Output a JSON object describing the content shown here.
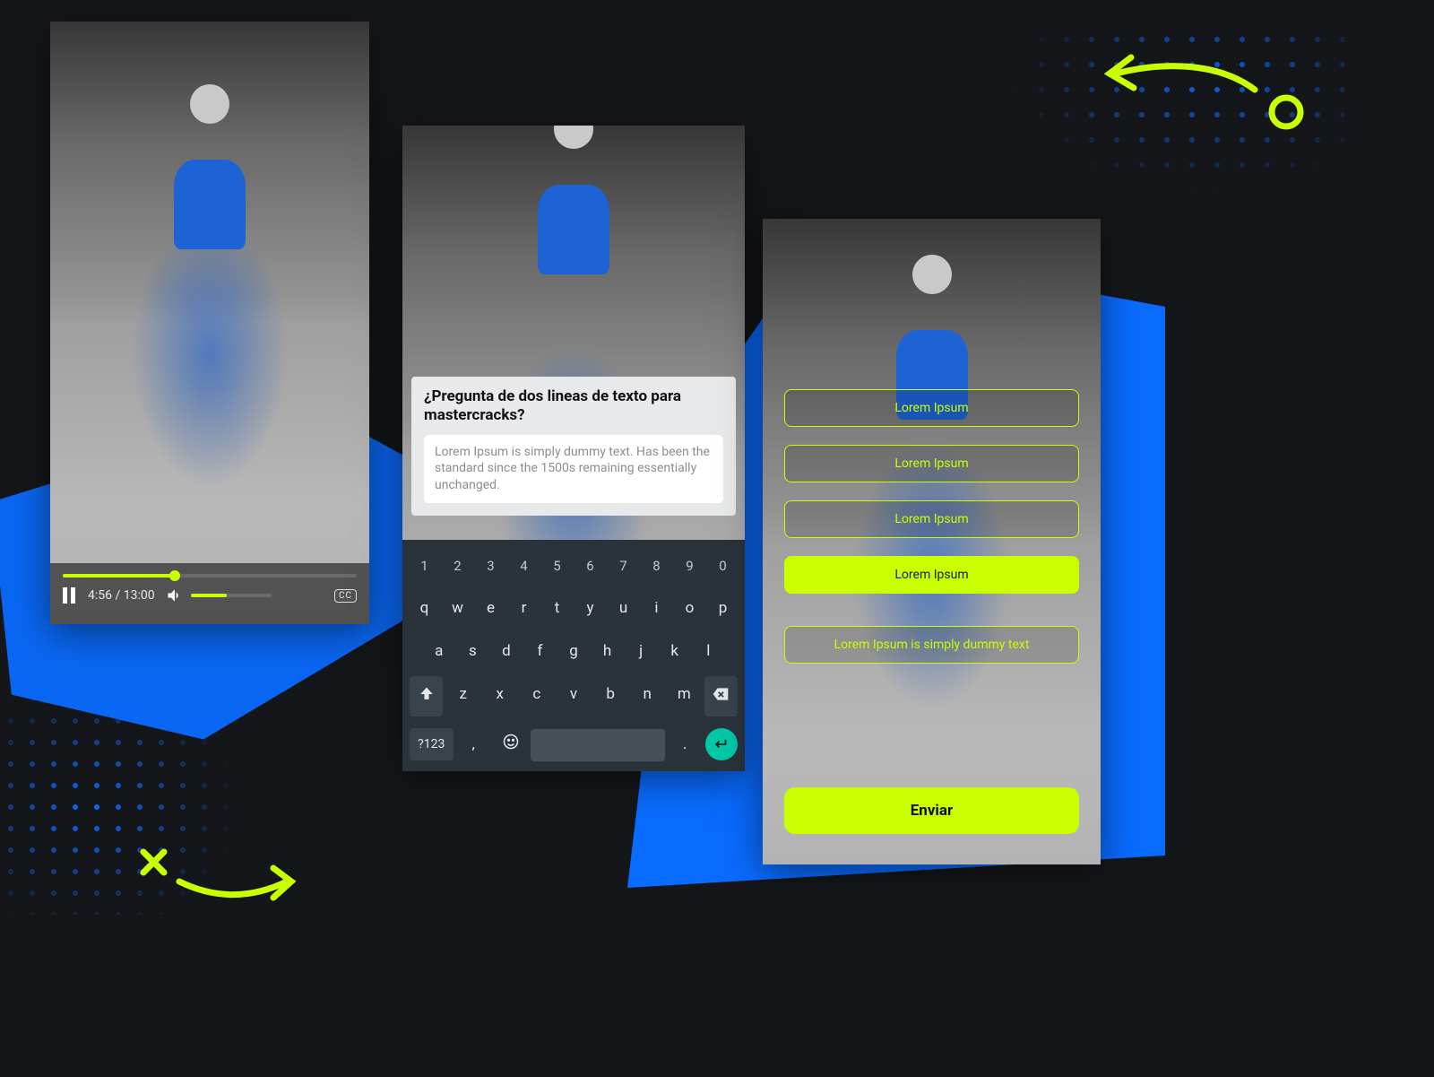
{
  "colors": {
    "accent": "#c9ff00",
    "pink": "#ff1dd0",
    "blue": "#0a6bff",
    "teal": "#00c8a8"
  },
  "video": {
    "current_time": "4:56",
    "total_time": "13:00",
    "time_display": "4:56 / 13:00",
    "progress_pct": 38,
    "volume_pct": 45,
    "cc_label": "CC"
  },
  "prompt": {
    "question": "¿Pregunta de dos lineas de texto para mastercracks?",
    "answer_text": "Lorem Ipsum is simply dummy text. Has been the standard since the 1500s remaining essentially unchanged."
  },
  "keyboard": {
    "row_nums": [
      "1",
      "2",
      "3",
      "4",
      "5",
      "6",
      "7",
      "8",
      "9",
      "0"
    ],
    "row1": [
      "q",
      "w",
      "e",
      "r",
      "t",
      "y",
      "u",
      "i",
      "o",
      "p"
    ],
    "row2": [
      "a",
      "s",
      "d",
      "f",
      "g",
      "h",
      "j",
      "k",
      "l"
    ],
    "row3_mid": [
      "z",
      "x",
      "c",
      "v",
      "b",
      "n",
      "m"
    ],
    "symbols_label": "?123",
    "comma": ",",
    "period": "."
  },
  "quiz": {
    "options": [
      {
        "label": "Lorem Ipsum",
        "selected": false
      },
      {
        "label": "Lorem Ipsum",
        "selected": false
      },
      {
        "label": "Lorem Ipsum",
        "selected": false
      },
      {
        "label": "Lorem Ipsum",
        "selected": true
      },
      {
        "label": "Lorem Ipsum is simply dummy text",
        "selected": false
      }
    ],
    "submit_label": "Enviar"
  }
}
